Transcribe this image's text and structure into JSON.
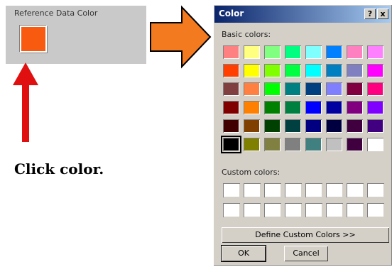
{
  "reference_panel": {
    "label": "Reference Data Color",
    "swatch_color": "#f85a10"
  },
  "instruction": "Click color.",
  "arrow_colors": {
    "right_arrow": "#f47a20",
    "up_arrow": "#e01010"
  },
  "dialog": {
    "title": "Color",
    "help_button": "?",
    "close_button": "x",
    "basic_colors_label": "Basic colors:",
    "custom_colors_label": "Custom colors:",
    "define_button": "Define Custom Colors >>",
    "ok_button": "OK",
    "cancel_button": "Cancel",
    "selected_index": 40,
    "basic_colors": [
      "#ff8080",
      "#ffff80",
      "#80ff80",
      "#00ff80",
      "#80ffff",
      "#0080ff",
      "#ff80c0",
      "#ff80ff",
      "#ff4000",
      "#ffff00",
      "#80ff00",
      "#00ff40",
      "#00ffff",
      "#0080c0",
      "#8080c0",
      "#ff00ff",
      "#804040",
      "#ff8040",
      "#00ff00",
      "#008080",
      "#004080",
      "#8080ff",
      "#800040",
      "#ff0080",
      "#800000",
      "#ff8000",
      "#008000",
      "#008040",
      "#0000ff",
      "#0000a0",
      "#800080",
      "#8000ff",
      "#400000",
      "#804000",
      "#004000",
      "#004040",
      "#000080",
      "#000040",
      "#400040",
      "#400080",
      "#000000",
      "#808000",
      "#808040",
      "#808080",
      "#408080",
      "#c0c0c0",
      "#400040",
      "#ffffff"
    ],
    "custom_colors": [
      "#ffffff",
      "#ffffff",
      "#ffffff",
      "#ffffff",
      "#ffffff",
      "#ffffff",
      "#ffffff",
      "#ffffff",
      "#ffffff",
      "#ffffff",
      "#ffffff",
      "#ffffff",
      "#ffffff",
      "#ffffff",
      "#ffffff",
      "#ffffff"
    ]
  }
}
